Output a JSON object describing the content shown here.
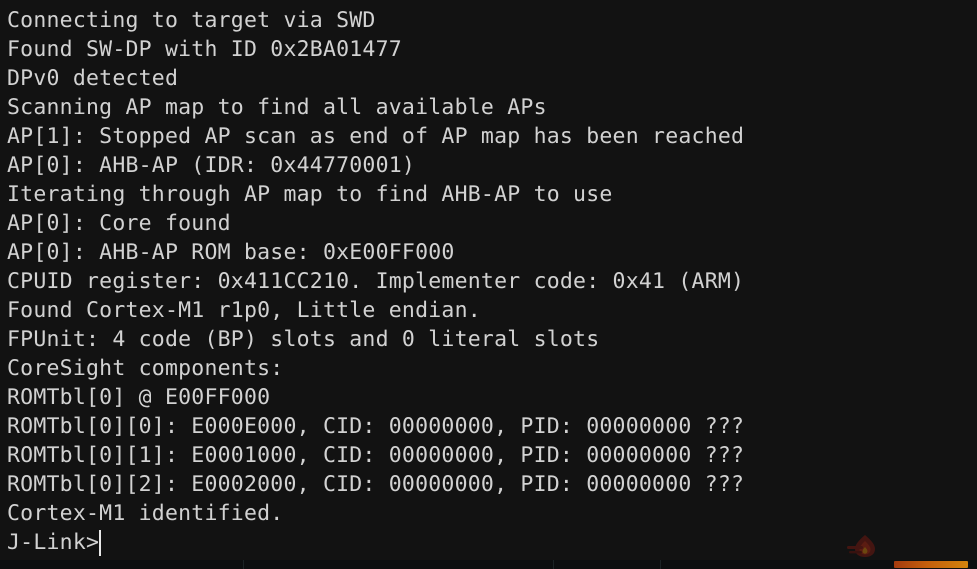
{
  "window": {
    "kind": "terminal-console",
    "title": "J-Link Commander",
    "background_color": "#121212",
    "foreground_color": "#d2d2d2"
  },
  "terminal": {
    "lines": [
      "Connecting to target via SWD",
      "Found SW-DP with ID 0x2BA01477",
      "DPv0 detected",
      "Scanning AP map to find all available APs",
      "AP[1]: Stopped AP scan as end of AP map has been reached",
      "AP[0]: AHB-AP (IDR: 0x44770001)",
      "Iterating through AP map to find AHB-AP to use",
      "AP[0]: Core found",
      "AP[0]: AHB-AP ROM base: 0xE00FF000",
      "CPUID register: 0x411CC210. Implementer code: 0x41 (ARM)",
      "Found Cortex-M1 r1p0, Little endian.",
      "FPUnit: 4 code (BP) slots and 0 literal slots",
      "CoreSight components:",
      "ROMTbl[0] @ E00FF000",
      "ROMTbl[0][0]: E000E000, CID: 00000000, PID: 00000000 ???",
      "ROMTbl[0][1]: E0001000, CID: 00000000, PID: 00000000 ???",
      "ROMTbl[0][2]: E0002000, CID: 00000000, PID: 00000000 ???",
      "Cortex-M1 identified."
    ],
    "prompt": "J-Link>",
    "input_value": "",
    "cursor_visible": true
  },
  "underlay": {
    "clipped_text": "",
    "accent_color": "#d9680c",
    "text_color": "#0d4a4f"
  },
  "watermark": {
    "word": "",
    "color": "#8a1a10"
  }
}
